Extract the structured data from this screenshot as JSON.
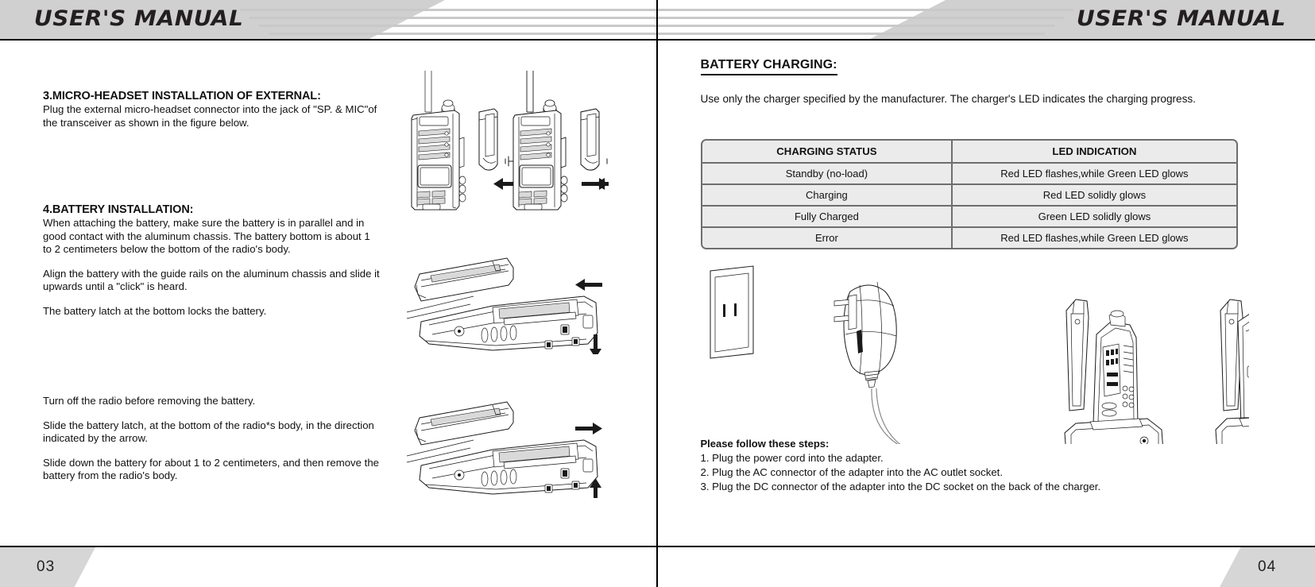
{
  "document": {
    "header_title_left": "USER'S MANUAL",
    "header_title_right": "USER'S MANUAL",
    "page_number_left": "03",
    "page_number_right": "04"
  },
  "left_page": {
    "section3": {
      "heading": "3.MICRO-HEADSET INSTALLATION OF EXTERNAL:",
      "body": "Plug the external micro-headset connector into the jack of \"SP. & MIC\"of the transceiver as shown in the figure below."
    },
    "section4": {
      "heading": "4.BATTERY INSTALLATION:",
      "paragraphs": [
        "When attaching the battery, make sure the battery is in parallel and in good contact with the aluminum chassis. The battery bottom is about 1 to 2 centimeters below the bottom of the radio's body.",
        "Align the battery with the guide rails on the aluminum chassis and slide it upwards until a \"click\" is heard.",
        "The battery latch at the bottom locks the battery."
      ],
      "removal_paragraphs": [
        "Turn off the radio before removing the battery.",
        "Slide the battery latch, at the bottom of the radio*s body, in the direction indicated by the arrow.",
        "Slide down the battery for about 1 to 2 centimeters, and then remove the battery from the radio's body."
      ]
    },
    "figures": {
      "headset_left_label": "radio-with-accessory-cover-left",
      "headset_right_label": "radio-with-accessory-cover-right",
      "battery_install_label": "battery-install-diagram",
      "battery_remove_label": "battery-remove-diagram"
    }
  },
  "right_page": {
    "heading": "BATTERY CHARGING:",
    "intro": "Use only the charger specified by the manufacturer. The charger's LED indicates the charging progress.",
    "table": {
      "columns": [
        "CHARGING STATUS",
        "LED INDICATION"
      ],
      "rows": [
        [
          "Standby (no-load)",
          "Red LED flashes,while Green LED glows"
        ],
        [
          "Charging",
          "Red LED solidly glows"
        ],
        [
          "Fully Charged",
          "Green LED solidly glows"
        ],
        [
          "Error",
          "Red LED flashes,while Green LED glows"
        ]
      ]
    },
    "steps": {
      "title": "Please follow these steps:",
      "items": [
        "1. Plug the power cord into the adapter.",
        "2. Plug the AC connector of the adapter into the AC outlet socket.",
        "3. Plug the DC connector of the adapter into the DC socket on the back of the charger."
      ]
    },
    "figures": {
      "wall_socket_label": "wall-outlet-icon",
      "adapter_label": "power-adapter-illustration",
      "charger_radio_label": "charger-with-radio-illustration",
      "charger_battery_label": "charger-with-battery-illustration"
    }
  },
  "theme": {
    "band_gray": "#d0d0d0",
    "stripe_gray": "#c9c9c9",
    "table_bg": "#ebebeb",
    "table_border": "#6e6e6e",
    "ink": "#231f20"
  }
}
